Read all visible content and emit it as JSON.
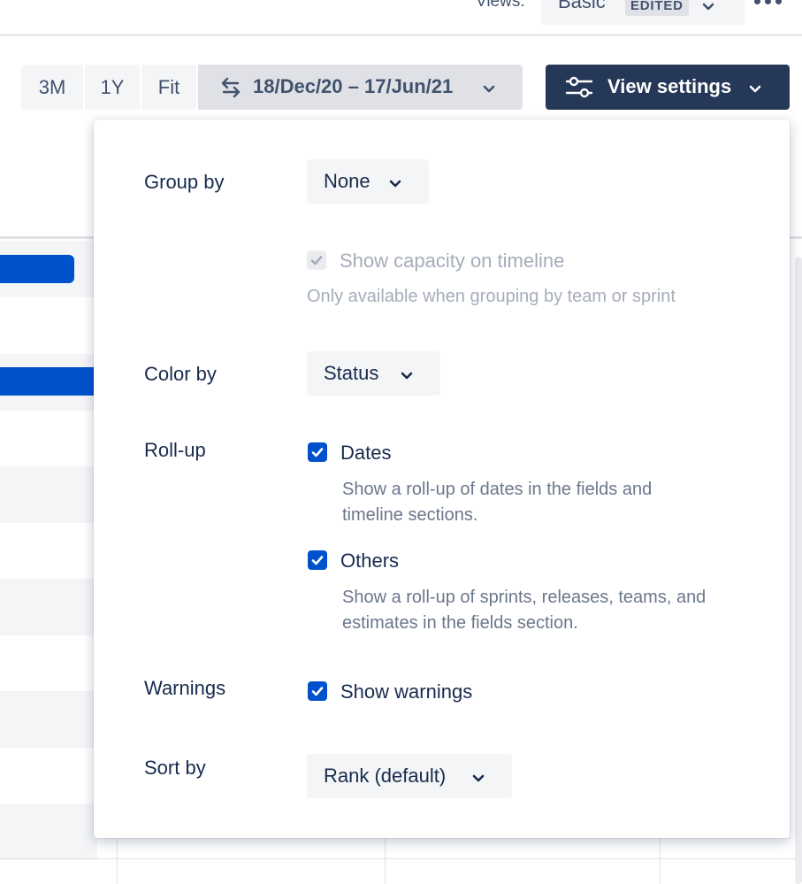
{
  "header": {
    "views_label": "Views:",
    "view_name": "Basic",
    "view_badge": "EDITED"
  },
  "toolbar": {
    "zoom_options": [
      "3M",
      "1Y",
      "Fit"
    ],
    "date_range": "18/Dec/20 – 17/Jun/21",
    "view_settings_label": "View settings"
  },
  "view_settings": {
    "group_by": {
      "label": "Group by",
      "value": "None"
    },
    "show_capacity": {
      "label": "Show capacity on timeline",
      "checked": true,
      "disabled": true,
      "help": "Only available when grouping by team or sprint"
    },
    "color_by": {
      "label": "Color by",
      "value": "Status"
    },
    "rollup": {
      "label": "Roll-up",
      "dates": {
        "label": "Dates",
        "checked": true,
        "help_line1": "Show a roll-up of dates in the fields and",
        "help_line2": "timeline sections."
      },
      "others": {
        "label": "Others",
        "checked": true,
        "help_line1": "Show a roll-up of sprints, releases, teams, and",
        "help_line2": "estimates in the fields section."
      }
    },
    "warnings": {
      "label": "Warnings",
      "checkbox_label": "Show warnings",
      "checked": true
    },
    "sort_by": {
      "label": "Sort by",
      "value": "Rank (default)"
    }
  },
  "colors": {
    "primary_button": "#253858",
    "checkbox_checked": "#0052CC",
    "timeline_bar": "#0052CC",
    "dropdown_bg": "#F4F5F7"
  },
  "icons": [
    "chevron-down-icon",
    "swap-arrows-icon",
    "sliders-icon",
    "more-dots-icon",
    "checkmark-icon"
  ]
}
